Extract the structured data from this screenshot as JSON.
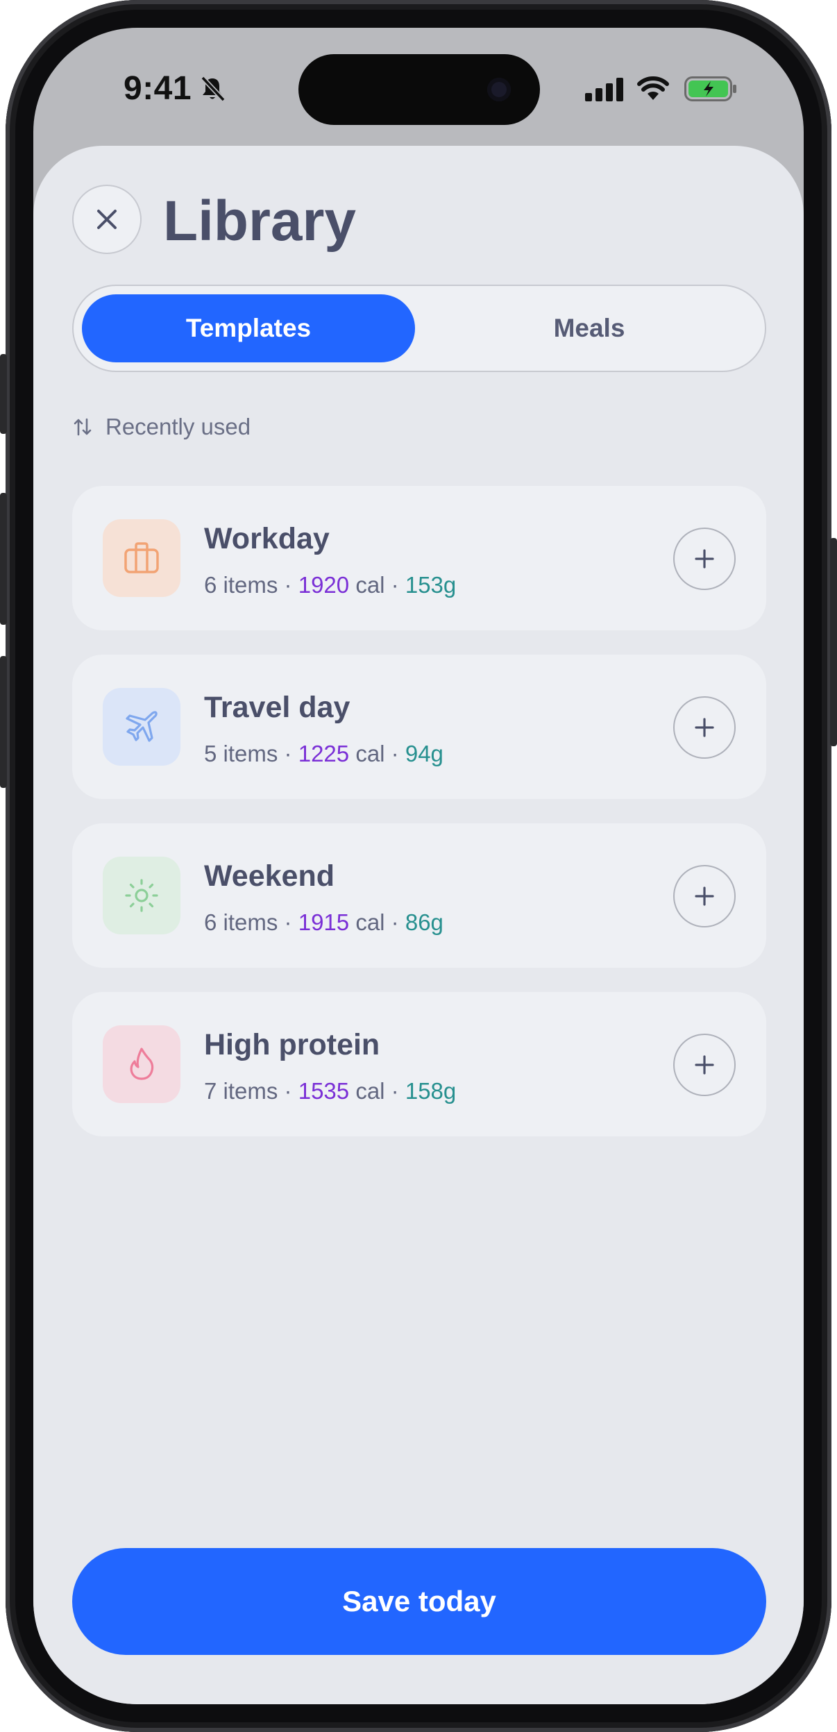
{
  "status_bar": {
    "time": "9:41",
    "icons": [
      "bell-slash-icon",
      "cellular-signal-icon",
      "wifi-icon",
      "battery-charging-icon"
    ]
  },
  "header": {
    "title": "Library",
    "close_icon": "close-icon"
  },
  "tabs": [
    {
      "label": "Templates",
      "selected": true
    },
    {
      "label": "Meals",
      "selected": false
    }
  ],
  "sort": {
    "icon": "sort-arrows-icon",
    "label": "Recently used"
  },
  "templates": [
    {
      "name": "Workday",
      "icon": "briefcase-icon",
      "items": "6 items",
      "calories": "1920",
      "cal_unit": "cal",
      "grams": "153g",
      "tile_color": "#f6e1d6",
      "icon_color": "#f2a374"
    },
    {
      "name": "Travel day",
      "icon": "airplane-icon",
      "items": "5 items",
      "calories": "1225",
      "cal_unit": "cal",
      "grams": "94g",
      "tile_color": "#dbe5f8",
      "icon_color": "#7fa7ee"
    },
    {
      "name": "Weekend",
      "icon": "sun-icon",
      "items": "6 items",
      "calories": "1915",
      "cal_unit": "cal",
      "grams": "86g",
      "tile_color": "#dfeee3",
      "icon_color": "#8ccf98"
    },
    {
      "name": "High protein",
      "icon": "flame-icon",
      "items": "7 items",
      "calories": "1535",
      "cal_unit": "cal",
      "grams": "158g",
      "tile_color": "#f4dbe2",
      "icon_color": "#ee7d9a"
    }
  ],
  "separator": "·",
  "add_icon": "plus-icon",
  "footer": {
    "save_label": "Save today"
  },
  "colors": {
    "accent": "#2266ff",
    "title_text": "#4a4f69",
    "calories": "#7a2fd6",
    "grams": "#27908f"
  }
}
